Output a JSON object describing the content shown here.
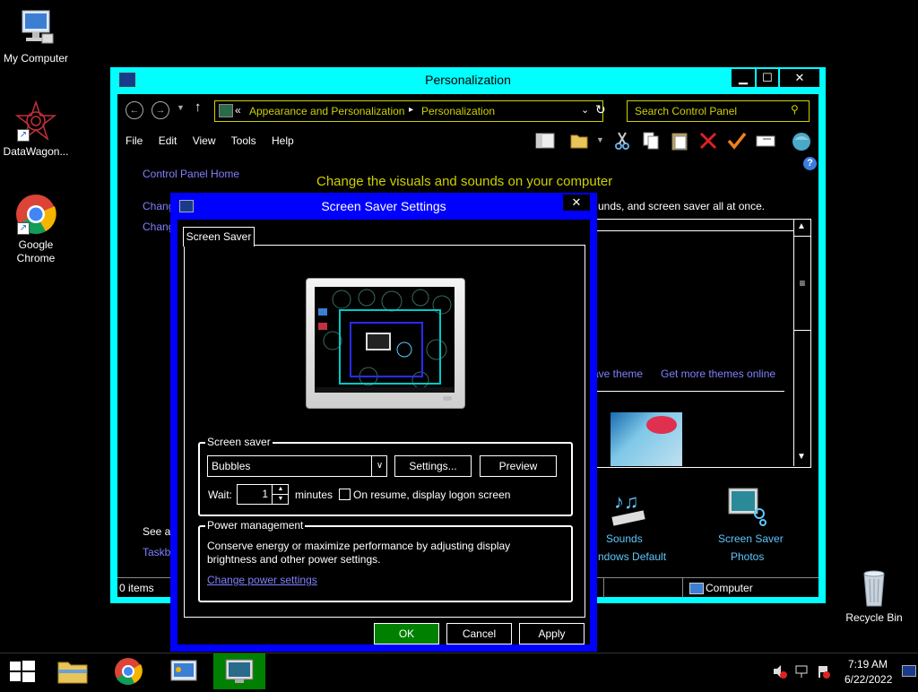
{
  "desktop": {
    "icons": [
      {
        "label": "My Computer"
      },
      {
        "label": "DataWagon..."
      },
      {
        "label": "Google Chrome"
      },
      {
        "label": "Recycle Bin"
      }
    ]
  },
  "personalization": {
    "title": "Personalization",
    "address": {
      "sep": "«",
      "crumb1": "Appearance and Personalization",
      "crumb2": "Personalization"
    },
    "search_placeholder": "Search Control Panel",
    "menu": [
      "File",
      "Edit",
      "View",
      "Tools",
      "Help"
    ],
    "left_links": {
      "home": "Control Panel Home",
      "change1": "Chang",
      "change2": "Chang",
      "see_also": "See al",
      "taskbar": "Taskb"
    },
    "heading": "Change the visuals and sounds on your computer",
    "subheading": "unds, and screen saver all at once.",
    "theme_links": {
      "save": "ave theme",
      "more": "Get more themes online"
    },
    "bottom_items": [
      {
        "title": "Sounds",
        "sub": "ndows Default"
      },
      {
        "title": "Screen Saver",
        "sub": "Photos"
      }
    ],
    "status": {
      "items": "0 items",
      "location": "Computer"
    }
  },
  "screensaver_dialog": {
    "title": "Screen Saver Settings",
    "tab": "Screen Saver",
    "screen_saver_group": {
      "label": "Screen saver",
      "selected": "Bubbles",
      "settings_btn": "Settings...",
      "preview_btn": "Preview",
      "wait_label": "Wait:",
      "wait_value": "1",
      "minutes": "minutes",
      "resume_label": "On resume, display logon screen"
    },
    "power_group": {
      "label": "Power management",
      "text1": "Conserve energy or maximize performance by adjusting display",
      "text2": "brightness and other power settings.",
      "link": "Change power settings"
    },
    "buttons": {
      "ok": "OK",
      "cancel": "Cancel",
      "apply": "Apply"
    }
  },
  "taskbar": {
    "time": "7:19 AM",
    "date": "6/22/2022"
  }
}
